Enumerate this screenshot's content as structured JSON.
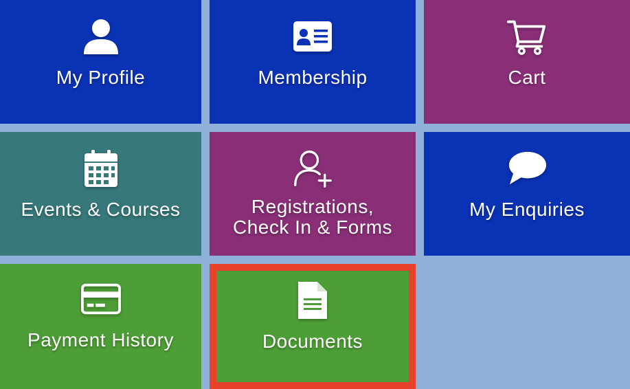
{
  "tiles": [
    {
      "label": "My Profile",
      "icon": "user-icon",
      "color": "#0a32b4"
    },
    {
      "label": "Membership",
      "icon": "id-card-icon",
      "color": "#0a32b4"
    },
    {
      "label": "Cart",
      "icon": "cart-icon",
      "color": "#8a2f77"
    },
    {
      "label": "Events & Courses",
      "icon": "calendar-icon",
      "color": "#37787a"
    },
    {
      "label": "Registrations,\nCheck In & Forms",
      "icon": "user-add-icon",
      "color": "#8a2f77"
    },
    {
      "label": "My Enquiries",
      "icon": "chat-bubble-icon",
      "color": "#0a32b4"
    },
    {
      "label": "Payment History",
      "icon": "credit-card-icon",
      "color": "#4d9e36"
    },
    {
      "label": "Documents",
      "icon": "document-icon",
      "color": "#4d9e36",
      "highlight_color": "#e8432a"
    }
  ],
  "background_color": "#8fb0d9"
}
